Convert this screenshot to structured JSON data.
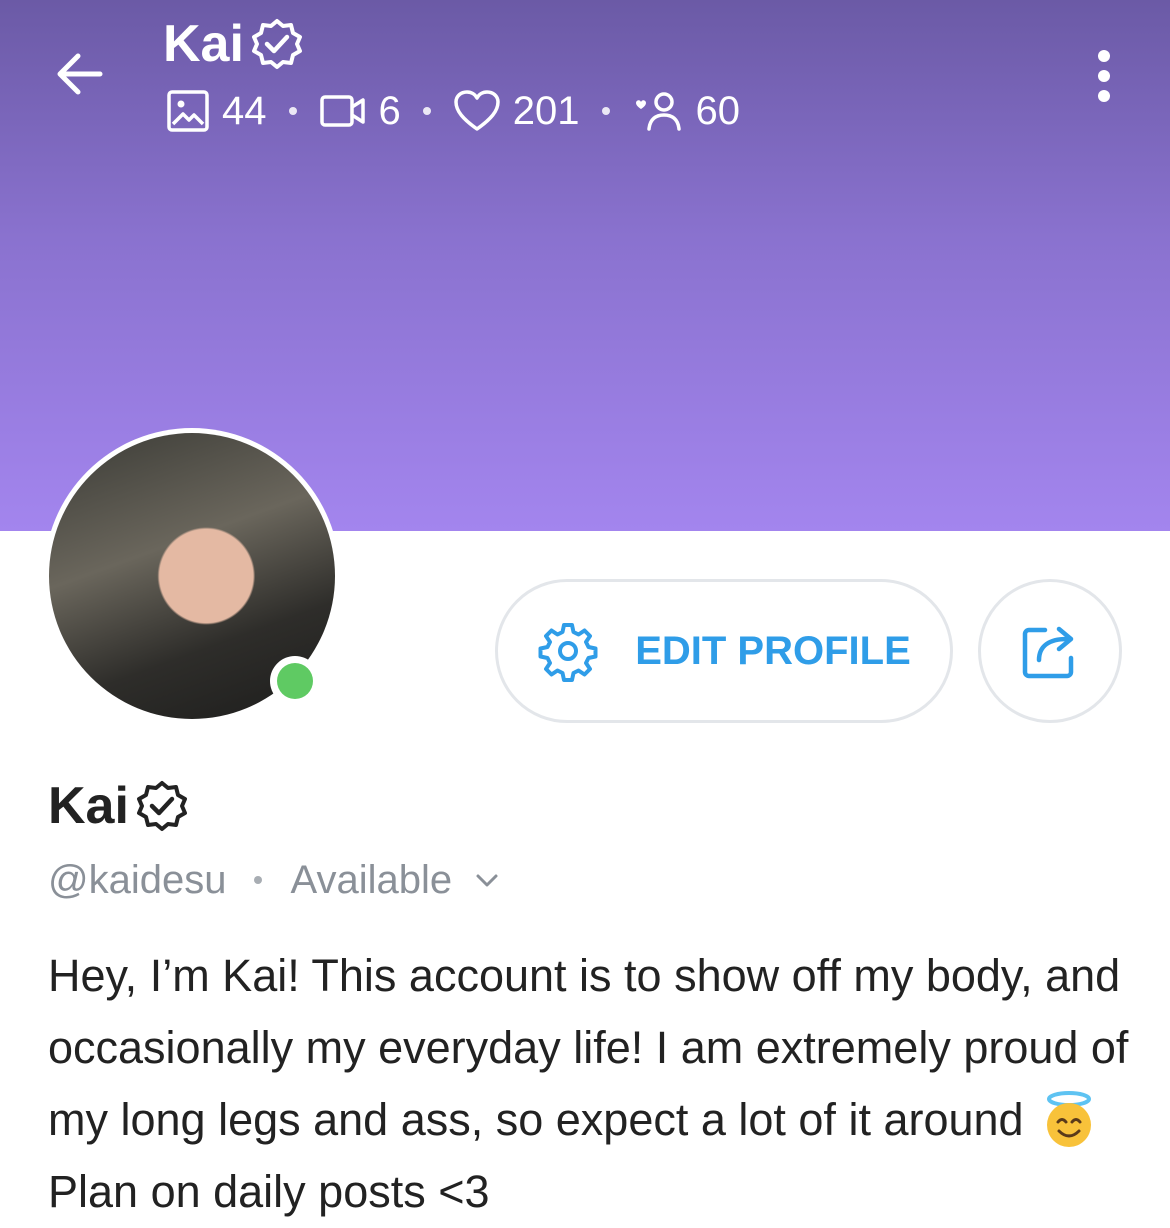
{
  "header": {
    "title": "Kai",
    "stats": {
      "photos": "44",
      "videos": "6",
      "likes": "201",
      "fans": "60"
    }
  },
  "profile": {
    "name": "Kai",
    "handle": "@kaidesu",
    "status": "Available",
    "online": true,
    "edit_label": "EDIT PROFILE",
    "bio_text": "Hey, I’m Kai! This account is to show off my body, and occasionally my everyday life! I am extremely proud of my long legs and ass, so expect a lot of it around",
    "bio_tail": "Plan on daily posts <3"
  },
  "colors": {
    "cover_top": "#6b5aa6",
    "cover_bottom": "#a385ee",
    "accent": "#2f9de8",
    "online": "#5fca63",
    "muted_text": "#8a9098"
  },
  "icons": {
    "back": "arrow-left-icon",
    "verified": "verified-badge-icon",
    "photos": "image-icon",
    "videos": "video-icon",
    "likes": "heart-icon",
    "fans": "fans-icon",
    "more": "more-vertical-icon",
    "settings": "gear-icon",
    "share": "share-icon",
    "emoji": "smiling-face-with-halo-emoji"
  }
}
